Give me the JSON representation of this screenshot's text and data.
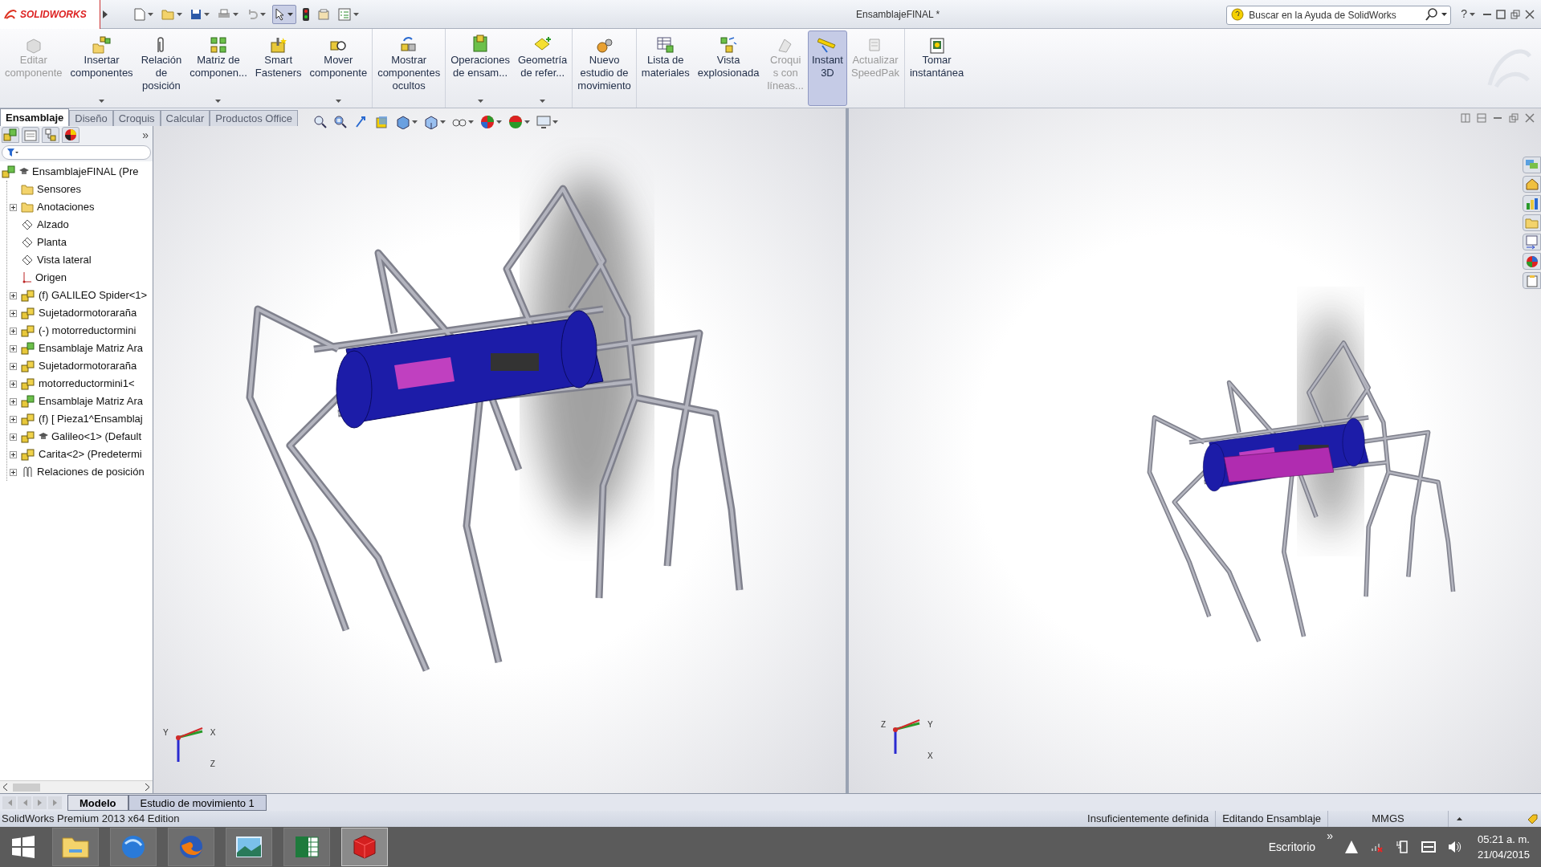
{
  "title_bar": {
    "logo": "SOLIDWORKS",
    "title": "EnsamblajeFINAL *",
    "search": {
      "placeholder": "Buscar en la Ayuda de SolidWorks"
    },
    "help": "?"
  },
  "ribbon": {
    "groups": [
      [
        {
          "label": "Editar\ncomponente",
          "disabled": true,
          "selected": false,
          "dropdown": false
        },
        {
          "label": "Insertar\ncomponentes",
          "disabled": false,
          "selected": false,
          "dropdown": true
        },
        {
          "label": "Relación\nde\nposición",
          "disabled": false,
          "selected": false,
          "dropdown": false
        },
        {
          "label": "Matriz de\ncomponen...",
          "disabled": false,
          "selected": false,
          "dropdown": true
        },
        {
          "label": "Smart\nFasteners",
          "disabled": false,
          "selected": false,
          "dropdown": false
        },
        {
          "label": "Mover\ncomponente",
          "disabled": false,
          "selected": false,
          "dropdown": true
        }
      ],
      [
        {
          "label": "Mostrar\ncomponentes\nocultos",
          "disabled": false,
          "selected": false,
          "dropdown": false
        }
      ],
      [
        {
          "label": "Operaciones\nde ensam...",
          "disabled": false,
          "selected": false,
          "dropdown": true
        },
        {
          "label": "Geometría\nde refer...",
          "disabled": false,
          "selected": false,
          "dropdown": true
        }
      ],
      [
        {
          "label": "Nuevo\nestudio de\nmovimiento",
          "disabled": false,
          "selected": false,
          "dropdown": false
        }
      ],
      [
        {
          "label": "Lista de\nmateriales",
          "disabled": false,
          "selected": false,
          "dropdown": false
        },
        {
          "label": "Vista\nexplosionada",
          "disabled": false,
          "selected": false,
          "dropdown": false
        },
        {
          "label": "Croqui\ns con\nlíneas...",
          "disabled": true,
          "selected": false,
          "dropdown": false
        },
        {
          "label": "Instant\n3D",
          "disabled": false,
          "selected": true,
          "dropdown": false
        },
        {
          "label": "Actualizar\nSpeedPak",
          "disabled": true,
          "selected": false,
          "dropdown": false
        }
      ],
      [
        {
          "label": "Tomar\ninstantánea",
          "disabled": false,
          "selected": false,
          "dropdown": false
        }
      ]
    ]
  },
  "command_tabs": [
    {
      "label": "Ensamblaje",
      "selected": true
    },
    {
      "label": "Diseño",
      "selected": false
    },
    {
      "label": "Croquis",
      "selected": false
    },
    {
      "label": "Calcular",
      "selected": false
    },
    {
      "label": "Productos Office",
      "selected": false
    }
  ],
  "manager_tabs": {
    "more": "»"
  },
  "feature_tree": [
    {
      "label": "EnsamblajeFINAL  (Pre",
      "kind": "assembly_root",
      "children": [
        {
          "label": "Sensores",
          "kind": "sensor_folder"
        },
        {
          "label": "Anotaciones",
          "kind": "annotation_folder",
          "expanded": false
        },
        {
          "label": "Alzado",
          "kind": "plane"
        },
        {
          "label": "Planta",
          "kind": "plane"
        },
        {
          "label": "Vista lateral",
          "kind": "plane"
        },
        {
          "label": "Origen",
          "kind": "origin"
        },
        {
          "label": "(f) GALILEO Spider<1>",
          "kind": "part",
          "expanded": false
        },
        {
          "label": "Sujetadormotoraraña",
          "kind": "part",
          "expanded": false
        },
        {
          "label": "(-) motorreductormini",
          "kind": "part",
          "expanded": false
        },
        {
          "label": "Ensamblaje Matriz Ara",
          "kind": "subassembly",
          "expanded": false
        },
        {
          "label": "Sujetadormotoraraña",
          "kind": "part",
          "expanded": false
        },
        {
          "label": "motorreductormini1<",
          "kind": "part",
          "expanded": false
        },
        {
          "label": "Ensamblaje Matriz Ara",
          "kind": "subassembly",
          "expanded": false
        },
        {
          "label": "(f) [ Pieza1^Ensamblaj",
          "kind": "part",
          "expanded": false
        },
        {
          "label": "Galileo<1> (Default",
          "kind": "part_hat",
          "expanded": false
        },
        {
          "label": "Carita<2> (Predetermi",
          "kind": "part",
          "expanded": false
        },
        {
          "label": "Relaciones de posición",
          "kind": "mates",
          "expanded": false
        }
      ]
    }
  ],
  "viewports": [
    {
      "triad": {
        "x": "X",
        "y": "Y",
        "z": "Z"
      }
    },
    {
      "triad": {
        "x": "X",
        "y": "Y",
        "z": "Z"
      }
    }
  ],
  "bottom_tabs": [
    {
      "label": "Modelo",
      "selected": true
    },
    {
      "label": "Estudio de movimiento 1",
      "selected": false
    }
  ],
  "status_bar": {
    "edition": "SolidWorks Premium 2013 x64 Edition",
    "fields": [
      "Insuficientemente definida",
      "Editando Ensamblaje",
      "MMGS"
    ]
  },
  "taskbar": {
    "apps": [
      {
        "kind": "explorer",
        "selected": false
      },
      {
        "kind": "browser_globe",
        "selected": false
      },
      {
        "kind": "firefox",
        "selected": false
      },
      {
        "kind": "photos",
        "selected": false
      },
      {
        "kind": "spreadsheet",
        "selected": false
      },
      {
        "kind": "cad",
        "selected": true
      }
    ],
    "toolbar_label": "Escritorio",
    "chevron": "»",
    "time": "05:21 a. m.",
    "date": "21/04/2015"
  }
}
